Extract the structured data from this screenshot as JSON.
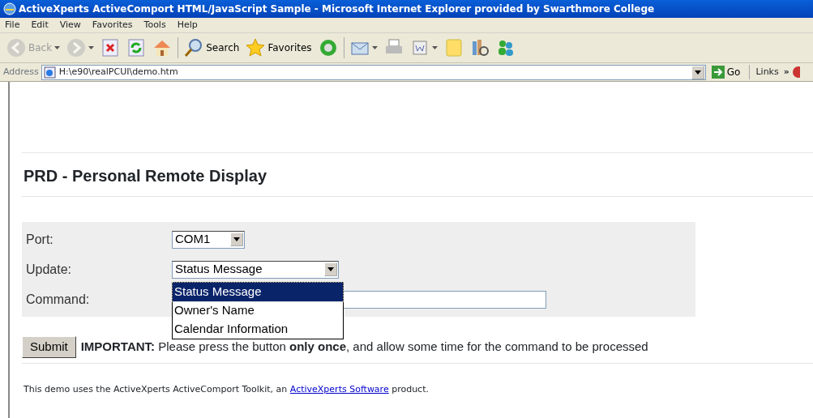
{
  "window": {
    "title": "ActiveXperts ActiveComport HTML/JavaScript Sample - Microsoft Internet Explorer provided by Swarthmore College"
  },
  "menu": [
    "File",
    "Edit",
    "View",
    "Favorites",
    "Tools",
    "Help"
  ],
  "toolbar": [
    {
      "kind": "back",
      "label": "Back",
      "disabled": true,
      "dropdown": true
    },
    {
      "kind": "forward",
      "disabled": true,
      "dropdown": true
    },
    {
      "kind": "stop"
    },
    {
      "kind": "refresh"
    },
    {
      "kind": "home"
    },
    {
      "kind": "search",
      "label": "Search"
    },
    {
      "kind": "favorites",
      "label": "Favorites"
    },
    {
      "kind": "media"
    },
    {
      "kind": "mail",
      "dropdown": true
    },
    {
      "kind": "print"
    },
    {
      "kind": "word",
      "dropdown": true
    },
    {
      "kind": "note"
    },
    {
      "kind": "research"
    },
    {
      "kind": "messenger"
    }
  ],
  "address": {
    "label": "Address",
    "value": "H:\\e90\\realPCUI\\demo.htm",
    "go": "Go",
    "links": "Links",
    "more": "»"
  },
  "page": {
    "heading": "PRD - Personal Remote Display",
    "form": {
      "port": {
        "label": "Port:",
        "value": "COM1"
      },
      "update": {
        "label": "Update:",
        "value": "Status Message",
        "expanded": true,
        "options": [
          {
            "label": "Status Message",
            "selected": true
          },
          {
            "label": "Owner's Name",
            "selected": false
          },
          {
            "label": "Calendar Information",
            "selected": false
          }
        ]
      },
      "command": {
        "label": "Command:"
      }
    },
    "submit": "Submit",
    "notice": "**IMPORTANT:** Please press the button **only once**, and allow some time for the command to be processed",
    "footer": {
      "before": "This demo uses the ActiveXperts ActiveComport Toolkit, an ",
      "link": "ActiveXperts Software",
      "after": " product."
    }
  }
}
